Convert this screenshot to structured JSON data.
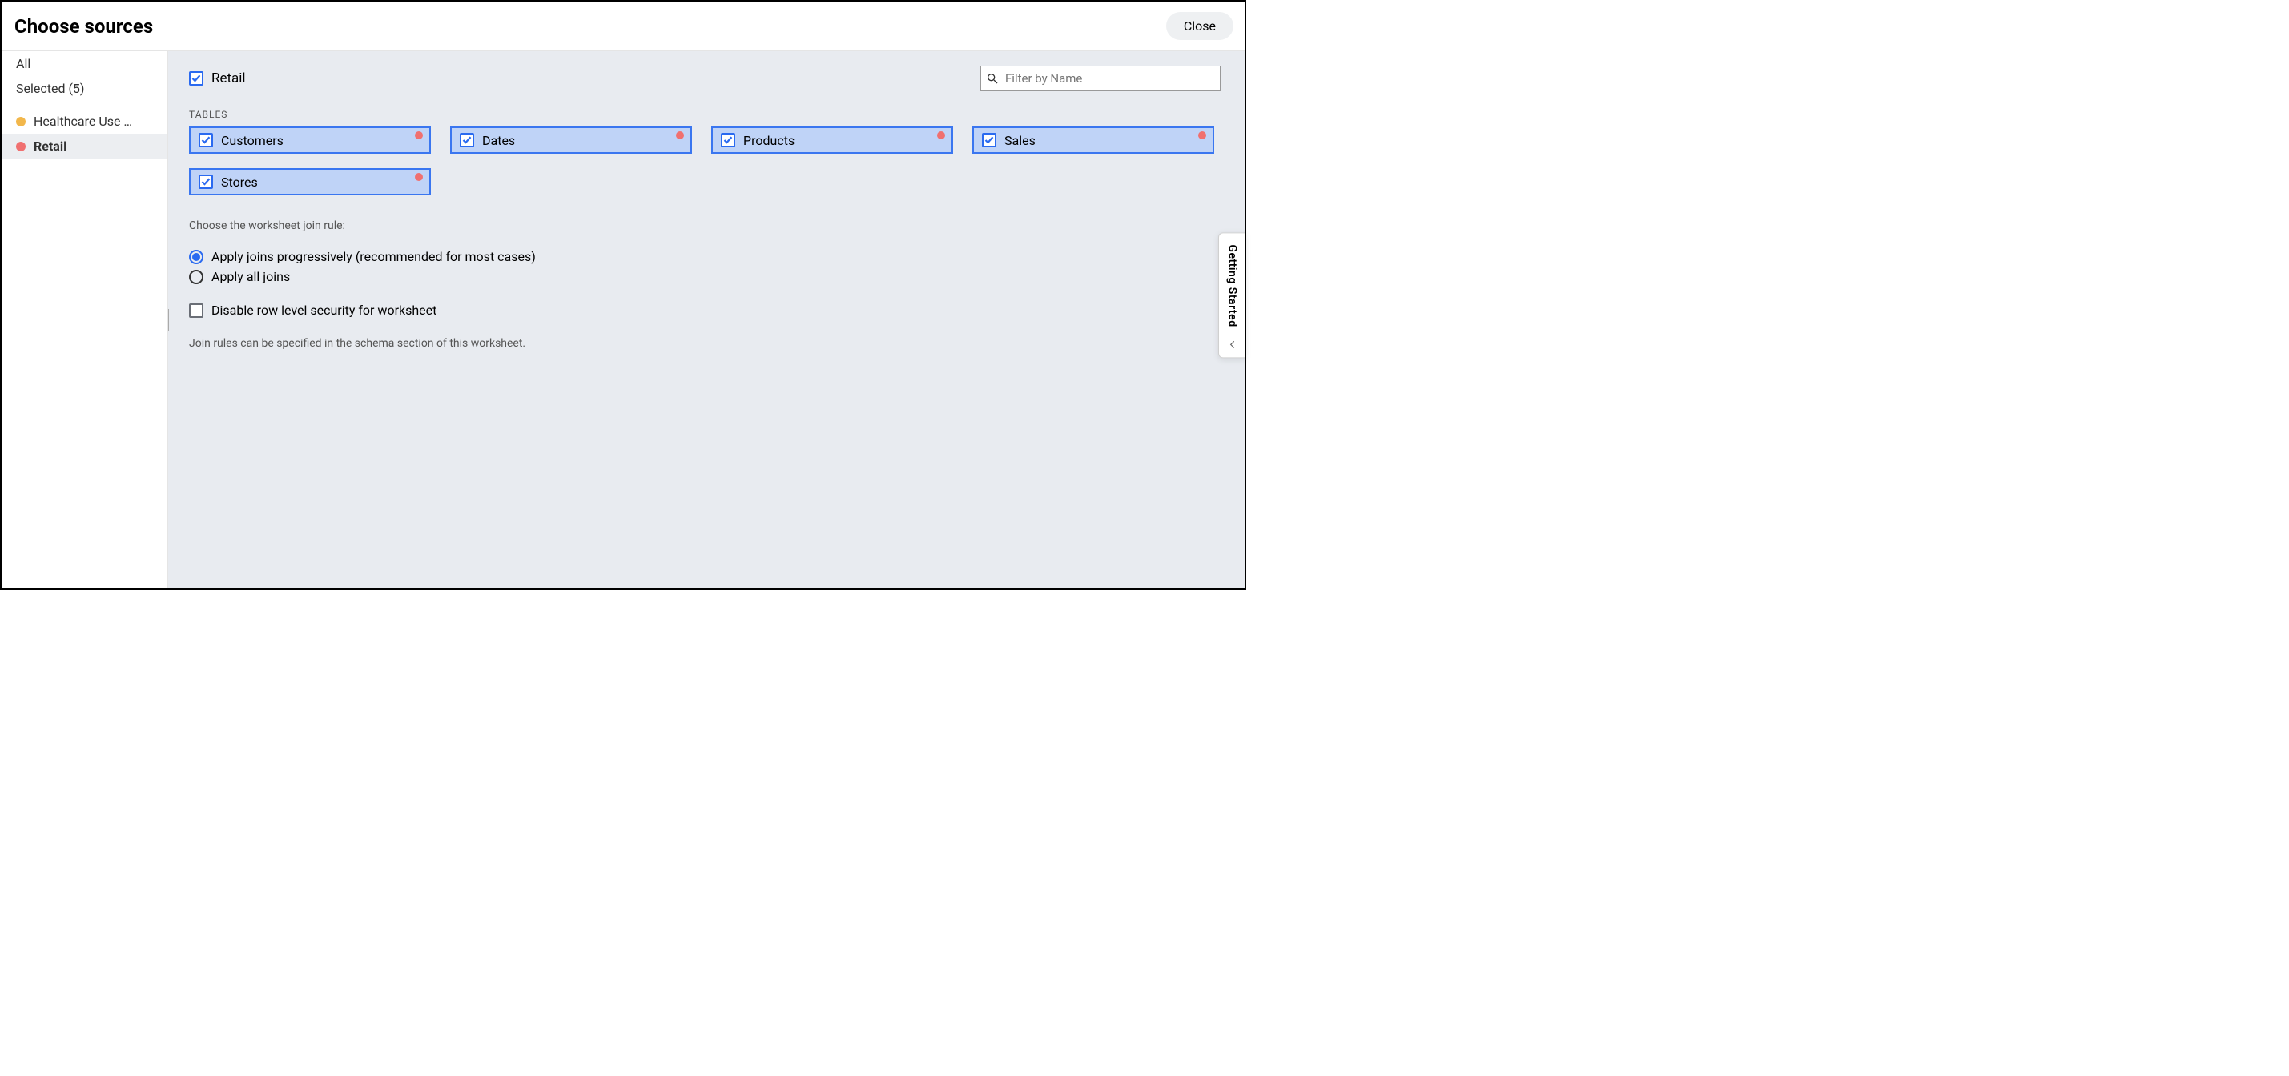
{
  "header": {
    "title": "Choose sources",
    "close_label": "Close"
  },
  "sidebar": {
    "all_label": "All",
    "selected_label": "Selected (5)",
    "items": [
      {
        "label": "Healthcare Use …",
        "dot": "orange",
        "selected": false
      },
      {
        "label": "Retail",
        "dot": "red",
        "selected": true
      }
    ]
  },
  "main": {
    "db_label": "Retail",
    "search_placeholder": "Filter by Name",
    "tables_heading": "TABLES",
    "tables": [
      {
        "label": "Customers"
      },
      {
        "label": "Dates"
      },
      {
        "label": "Products"
      },
      {
        "label": "Sales"
      },
      {
        "label": "Stores"
      }
    ],
    "join_rule_label": "Choose the worksheet join rule:",
    "join_options": [
      {
        "label": "Apply joins progressively (recommended for most cases)",
        "selected": true
      },
      {
        "label": "Apply all joins",
        "selected": false
      }
    ],
    "rls_checkbox_label": "Disable row level security for worksheet",
    "hint": "Join rules can be specified in the schema section of this worksheet."
  },
  "getting_started_label": "Getting Started"
}
